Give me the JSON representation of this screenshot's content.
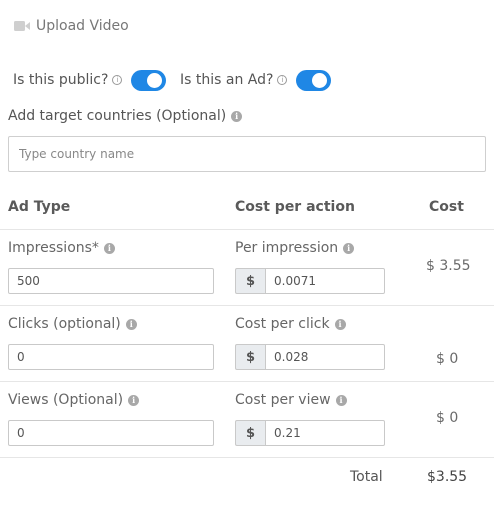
{
  "upload": {
    "label": "Upload Video"
  },
  "toggles": {
    "public": {
      "label": "Is this public?",
      "on": true
    },
    "ad": {
      "label": "Is this an Ad?",
      "on": true
    }
  },
  "countries": {
    "label": "Add target countries (Optional)",
    "placeholder": "Type country name",
    "value": ""
  },
  "table": {
    "headers": {
      "ad_type": "Ad Type",
      "cost_per_action": "Cost per action",
      "cost": "Cost"
    },
    "rows": [
      {
        "label": "Impressions*",
        "value": "500",
        "rate_label": "Per impression",
        "currency": "$",
        "rate": "0.0071",
        "cost": "$ 3.55"
      },
      {
        "label": "Clicks (optional)",
        "value": "0",
        "rate_label": "Cost per click",
        "currency": "$",
        "rate": "0.028",
        "cost": "$ 0"
      },
      {
        "label": "Views (Optional)",
        "value": "0",
        "rate_label": "Cost per view",
        "currency": "$",
        "rate": "0.21",
        "cost": "$ 0"
      }
    ],
    "total_label": "Total",
    "total_value": "$3.55"
  },
  "colors": {
    "accent": "#1f87e5",
    "info_icon": "#a8a8a8"
  }
}
